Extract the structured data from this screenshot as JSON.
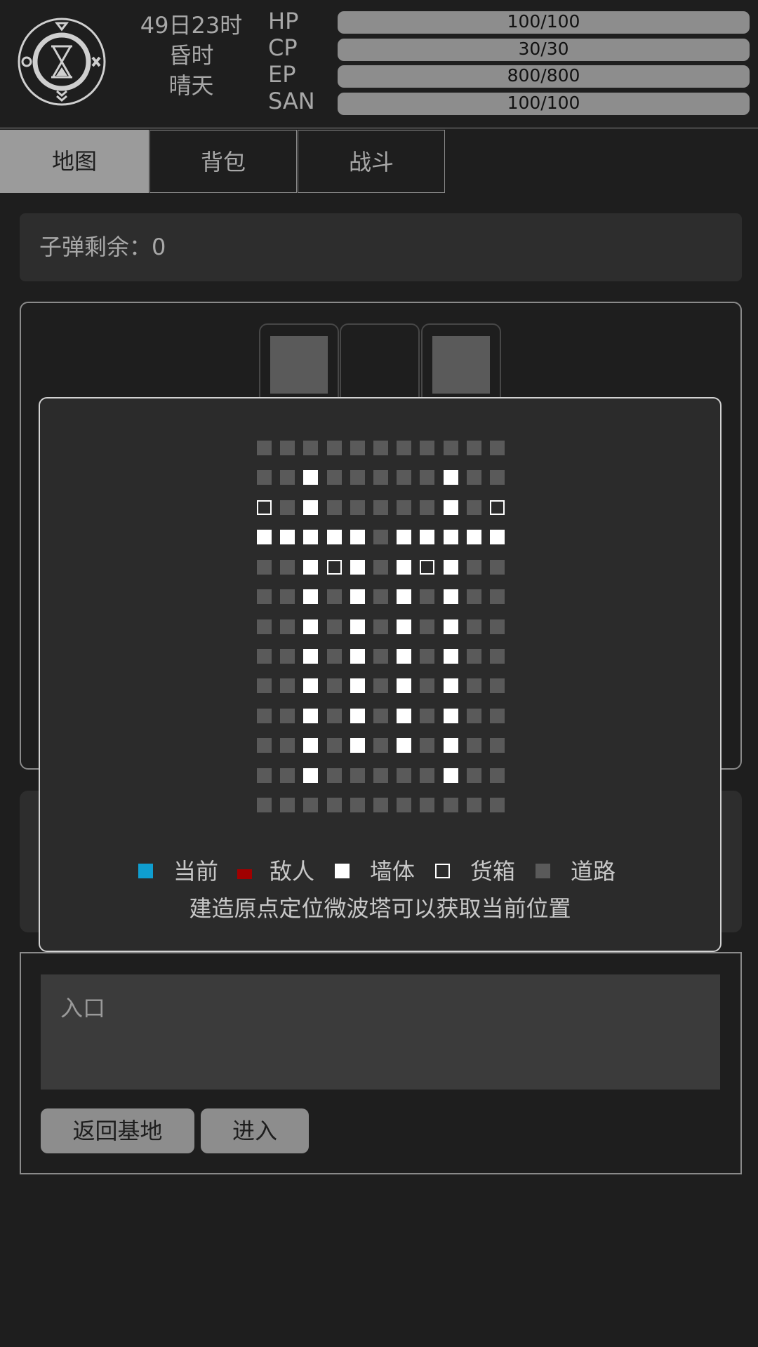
{
  "header": {
    "clock_icon": "hourglass-compass-icon",
    "time": "49日23时",
    "period": "昏时",
    "weather": "晴天",
    "stats": [
      {
        "label": "HP",
        "value": "100/100",
        "fill": 1.0
      },
      {
        "label": "CP",
        "value": "30/30",
        "fill": 1.0
      },
      {
        "label": "EP",
        "value": "800/800",
        "fill": 1.0
      },
      {
        "label": "SAN",
        "value": "100/100",
        "fill": 1.0
      }
    ]
  },
  "tabs": [
    {
      "label": "地图",
      "active": true
    },
    {
      "label": "背包",
      "active": false
    },
    {
      "label": "战斗",
      "active": false
    }
  ],
  "ammo": {
    "text": "子弹剩余：0"
  },
  "map": {
    "grid_rows": [
      "RRRRRRRRRRR",
      "RRWRRRRRWRR",
      "CRWRRRRRWRC",
      "WWWWWRWWWWW",
      "RRWCWRWCWRR",
      "RRWRWRWRWRR",
      "RRWRWRWRWRR",
      "RRWRWRWRWRR",
      "RRWRWRWRWRR",
      "RRWRWRWRWRR",
      "RRWRWRWRWRR",
      "RRWRRRRRWRR",
      "RRRRRRRRRRR"
    ],
    "grid_key": {
      "R": "road",
      "W": "wall",
      "C": "crate"
    },
    "colors": {
      "current": "#0f9ed0",
      "enemy": "#a00000",
      "wall": "#ffffff",
      "crate": "#ffffff",
      "road": "#5a5a5a"
    },
    "legend": {
      "current": "当前",
      "enemy": "敌人",
      "wall": "墙体",
      "crate": "货箱",
      "road": "道路"
    },
    "hint": "建造原点定位微波塔可以获取当前位置"
  },
  "entry": {
    "label": "入口"
  },
  "buttons": {
    "return": "返回基地",
    "enter": "进入"
  }
}
